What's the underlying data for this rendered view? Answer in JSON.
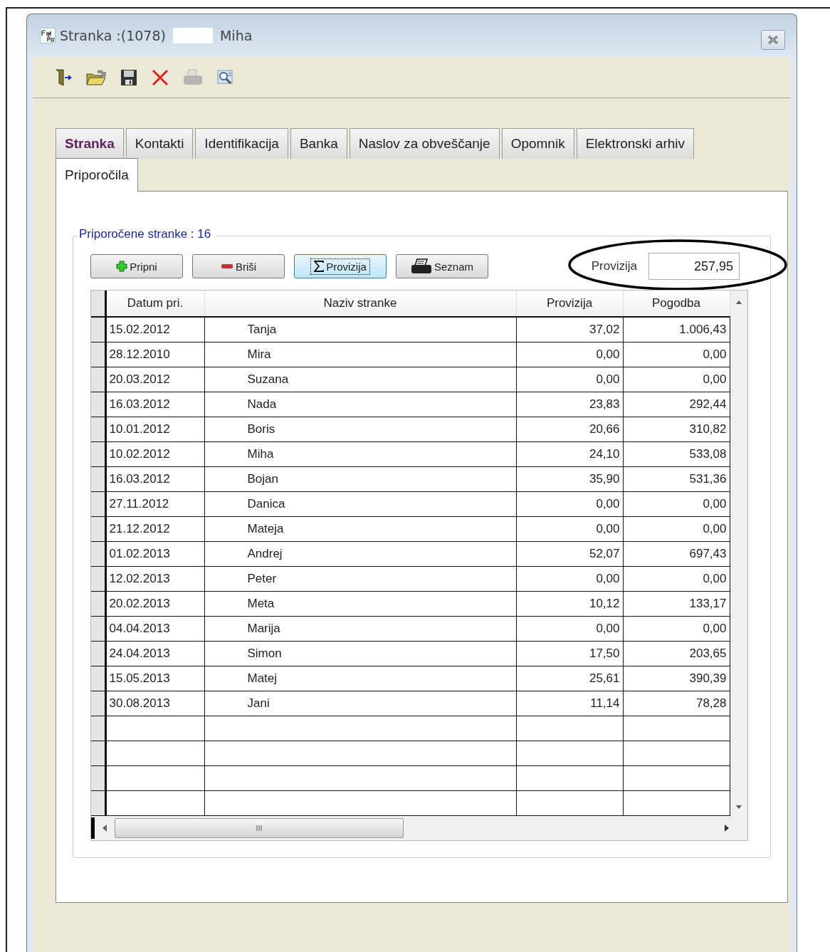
{
  "window": {
    "title": "Stranka :(1078)",
    "title_name": "Miha"
  },
  "toolbar": [
    {
      "kind": "exit",
      "disabled": false
    },
    {
      "kind": "open",
      "disabled": false
    },
    {
      "kind": "save",
      "disabled": false
    },
    {
      "kind": "delete",
      "disabled": false
    },
    {
      "kind": "print",
      "disabled": true
    },
    {
      "kind": "preview",
      "disabled": false
    }
  ],
  "tabs": [
    {
      "label": "Stranka",
      "highlighted": true,
      "selected": false
    },
    {
      "label": "Kontakti",
      "highlighted": false,
      "selected": false
    },
    {
      "label": "Identifikacija",
      "highlighted": false,
      "selected": false
    },
    {
      "label": "Banka",
      "highlighted": false,
      "selected": false
    },
    {
      "label": "Naslov za obveščanje",
      "highlighted": false,
      "selected": false
    },
    {
      "label": "Opomnik",
      "highlighted": false,
      "selected": false
    },
    {
      "label": "Elektronski arhiv",
      "highlighted": false,
      "selected": false
    },
    {
      "label": "Priporočila",
      "highlighted": false,
      "selected": true
    }
  ],
  "group": {
    "title": "Priporočene stranke : 16"
  },
  "buttons": [
    {
      "kind": "add",
      "label": "Pripni",
      "focused": false
    },
    {
      "kind": "remove",
      "label": "Briši",
      "focused": false
    },
    {
      "kind": "sum",
      "label": "Provizija",
      "focused": true
    },
    {
      "kind": "print",
      "label": "Seznam",
      "focused": false
    }
  ],
  "total": {
    "label": "Provizija",
    "value": "257,95"
  },
  "table": {
    "columns": [
      "Datum pri.",
      "Naziv stranke",
      "Provizija",
      "Pogodba"
    ],
    "rows": [
      [
        "15.02.2012",
        "Tanja",
        "37,02",
        "1.006,43"
      ],
      [
        "28.12.2010",
        "Mira",
        "0,00",
        "0,00"
      ],
      [
        "20.03.2012",
        "Suzana",
        "0,00",
        "0,00"
      ],
      [
        "16.03.2012",
        "Nada",
        "23,83",
        "292,44"
      ],
      [
        "10.01.2012",
        "Boris",
        "20,66",
        "310,82"
      ],
      [
        "10.02.2012",
        "Miha",
        "24,10",
        "533,08"
      ],
      [
        "16.03.2012",
        "Bojan",
        "35,90",
        "531,36"
      ],
      [
        "27.11.2012",
        "Danica",
        "0,00",
        "0,00"
      ],
      [
        "21.12.2012",
        "Mateja",
        "0,00",
        "0,00"
      ],
      [
        "01.02.2013",
        "Andrej",
        "52,07",
        "697,43"
      ],
      [
        "12.02.2013",
        "Peter",
        "0,00",
        "0,00"
      ],
      [
        "20.02.2013",
        "Meta",
        "10,12",
        "133,17"
      ],
      [
        "04.04.2013",
        "Marija",
        "0,00",
        "0,00"
      ],
      [
        "24.04.2013",
        "Simon",
        "17,50",
        "203,65"
      ],
      [
        "15.05.2013",
        "Matej",
        "25,61",
        "390,39"
      ],
      [
        "30.08.2013",
        "Jani",
        "11,14",
        "78,28"
      ]
    ]
  }
}
